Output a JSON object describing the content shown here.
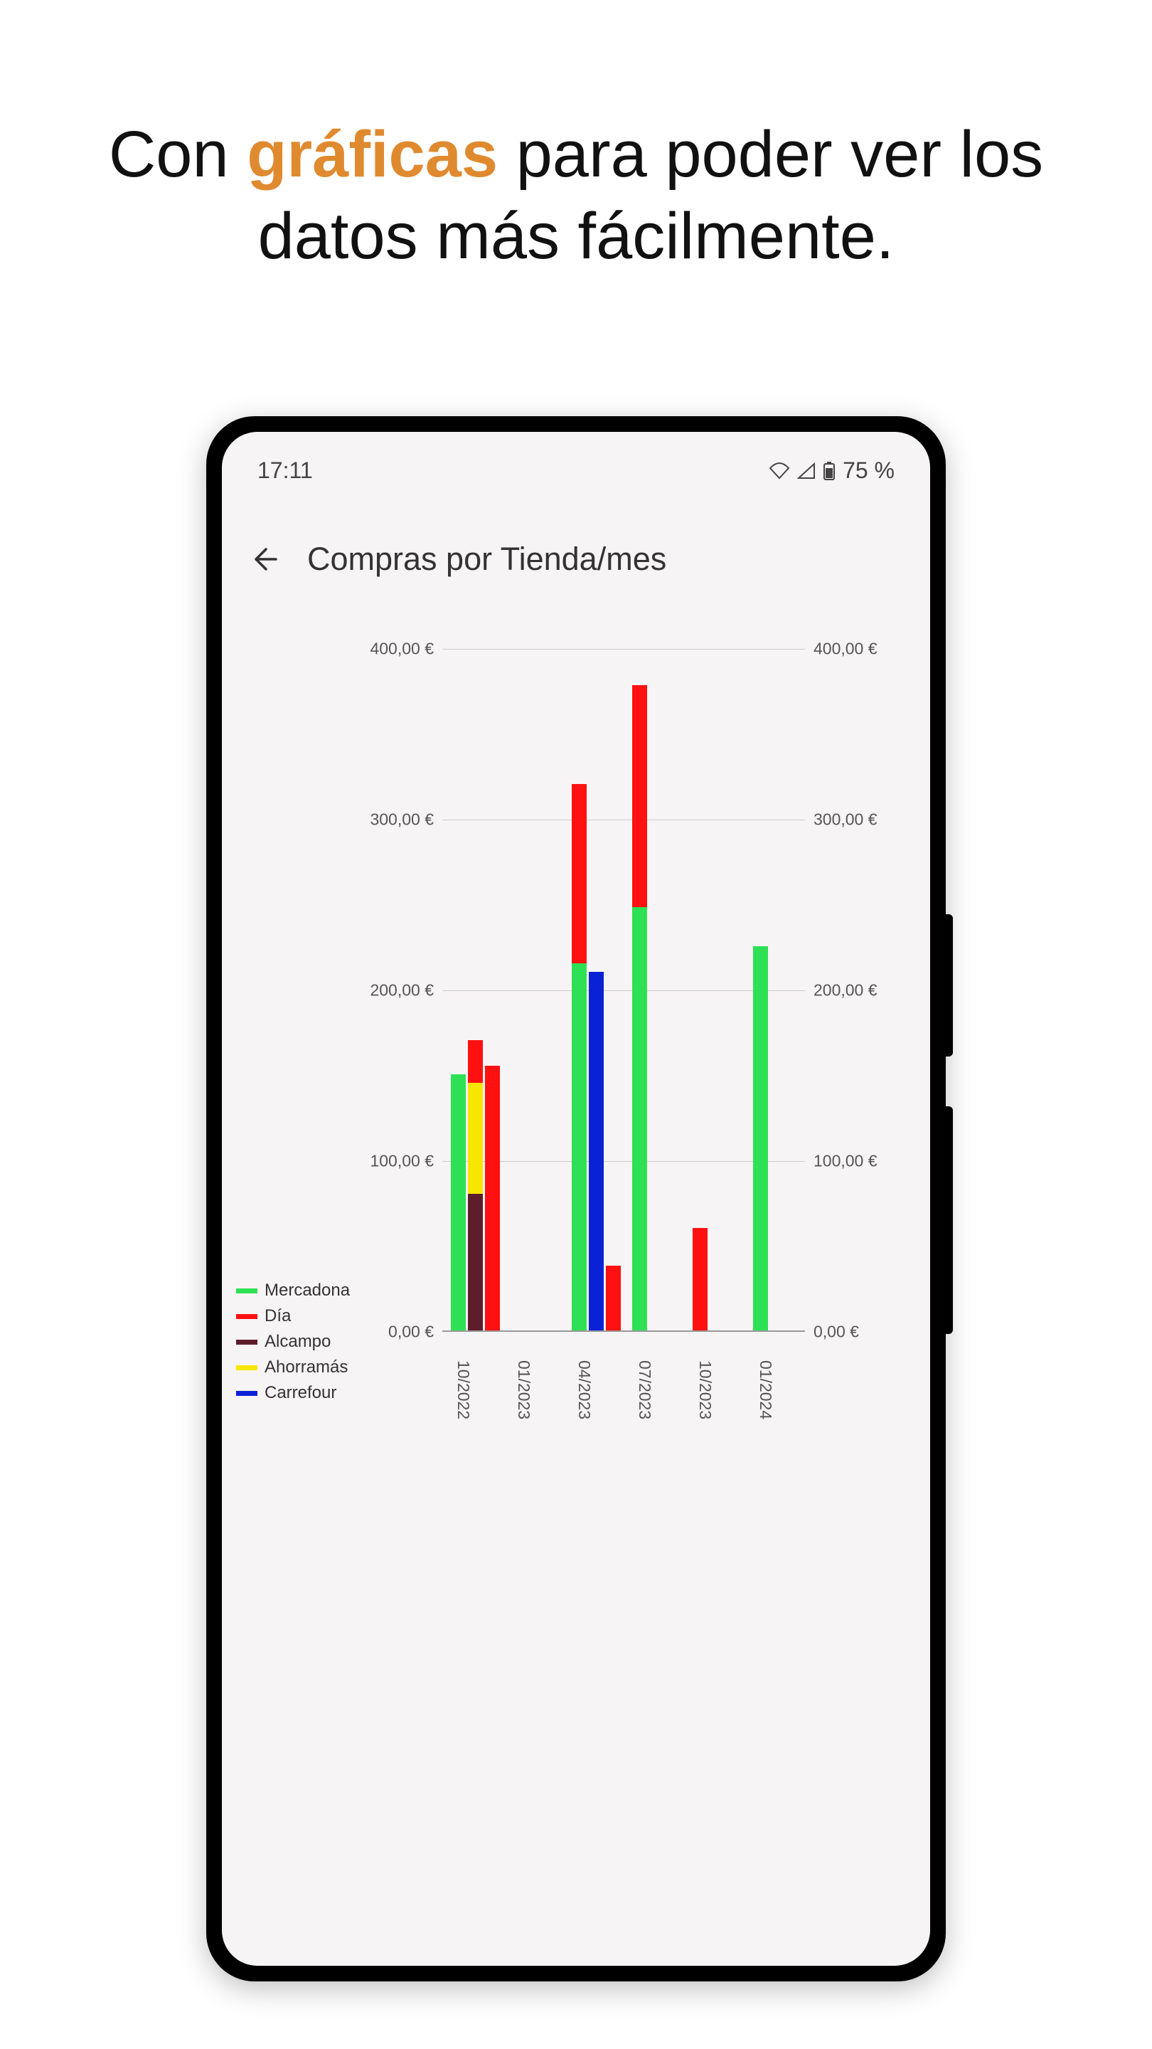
{
  "headline": {
    "prefix": "Con ",
    "accent": "gráficas",
    "suffix": " para poder ver los datos más fácilmente."
  },
  "statusbar": {
    "time": "17:11",
    "battery": "75 %"
  },
  "page": {
    "title": "Compras por Tienda/mes"
  },
  "chart_data": {
    "type": "bar",
    "title": "Compras por Tienda/mes",
    "ylabel": "€",
    "ylim": [
      0,
      400
    ],
    "yticks": [
      "0,00 €",
      "100,00 €",
      "200,00 €",
      "300,00 €",
      "400,00 €"
    ],
    "categories": [
      "10/2022",
      "01/2023",
      "04/2023",
      "07/2023",
      "10/2023",
      "01/2024"
    ],
    "legend": [
      {
        "name": "Mercadona",
        "color": "#2ee054"
      },
      {
        "name": "Día",
        "color": "#ff1111"
      },
      {
        "name": "Alcampo",
        "color": "#5e1d2b"
      },
      {
        "name": "Ahorramás",
        "color": "#f7e600"
      },
      {
        "name": "Carrefour",
        "color": "#0a22d6"
      }
    ],
    "groups": [
      {
        "cat": "10/2022",
        "columns": [
          [
            {
              "series": "Mercadona",
              "value": 150
            }
          ],
          [
            {
              "series": "Alcampo",
              "value": 80
            },
            {
              "series": "Ahorramás",
              "value": 65
            },
            {
              "series": "Día",
              "value": 25
            }
          ],
          [
            {
              "series": "Día",
              "value": 155
            }
          ]
        ]
      },
      {
        "cat": "04/2023",
        "columns": [
          [
            {
              "series": "Mercadona",
              "value": 215
            },
            {
              "series": "Día",
              "value": 105
            }
          ],
          [
            {
              "series": "Carrefour",
              "value": 210
            }
          ],
          [
            {
              "series": "Día",
              "value": 38
            }
          ]
        ]
      },
      {
        "cat": "07/2023",
        "columns": [
          [
            {
              "series": "Mercadona",
              "value": 248
            },
            {
              "series": "Día",
              "value": 130
            }
          ]
        ]
      },
      {
        "cat": "10/2023",
        "columns": [
          [
            {
              "series": "Día",
              "value": 60
            }
          ]
        ]
      },
      {
        "cat": "01/2024",
        "columns": [
          [
            {
              "series": "Mercadona",
              "value": 225
            }
          ]
        ]
      }
    ]
  }
}
